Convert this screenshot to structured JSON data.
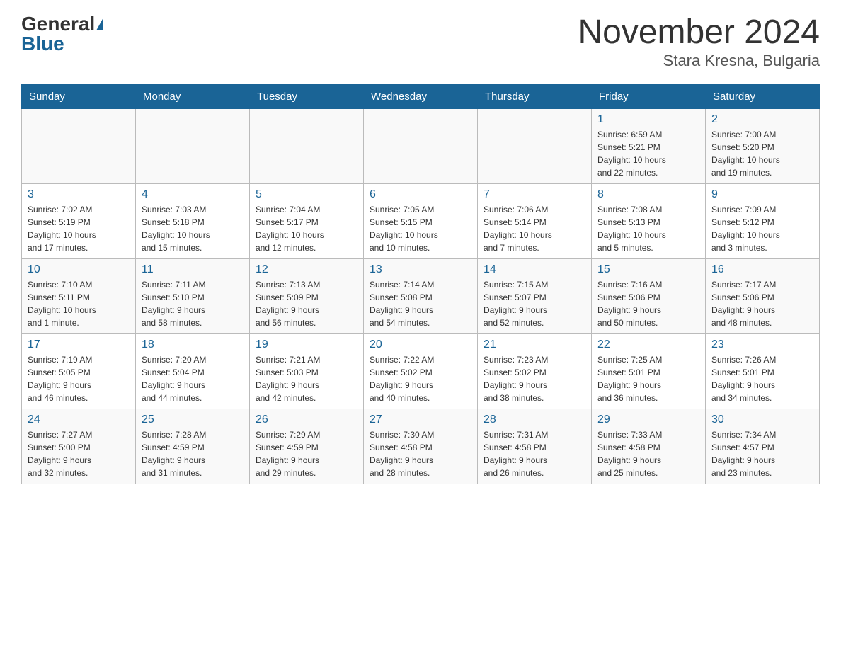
{
  "header": {
    "logo_general": "General",
    "logo_blue": "Blue",
    "title": "November 2024",
    "subtitle": "Stara Kresna, Bulgaria"
  },
  "weekdays": [
    "Sunday",
    "Monday",
    "Tuesday",
    "Wednesday",
    "Thursday",
    "Friday",
    "Saturday"
  ],
  "weeks": [
    [
      {
        "day": "",
        "info": ""
      },
      {
        "day": "",
        "info": ""
      },
      {
        "day": "",
        "info": ""
      },
      {
        "day": "",
        "info": ""
      },
      {
        "day": "",
        "info": ""
      },
      {
        "day": "1",
        "info": "Sunrise: 6:59 AM\nSunset: 5:21 PM\nDaylight: 10 hours\nand 22 minutes."
      },
      {
        "day": "2",
        "info": "Sunrise: 7:00 AM\nSunset: 5:20 PM\nDaylight: 10 hours\nand 19 minutes."
      }
    ],
    [
      {
        "day": "3",
        "info": "Sunrise: 7:02 AM\nSunset: 5:19 PM\nDaylight: 10 hours\nand 17 minutes."
      },
      {
        "day": "4",
        "info": "Sunrise: 7:03 AM\nSunset: 5:18 PM\nDaylight: 10 hours\nand 15 minutes."
      },
      {
        "day": "5",
        "info": "Sunrise: 7:04 AM\nSunset: 5:17 PM\nDaylight: 10 hours\nand 12 minutes."
      },
      {
        "day": "6",
        "info": "Sunrise: 7:05 AM\nSunset: 5:15 PM\nDaylight: 10 hours\nand 10 minutes."
      },
      {
        "day": "7",
        "info": "Sunrise: 7:06 AM\nSunset: 5:14 PM\nDaylight: 10 hours\nand 7 minutes."
      },
      {
        "day": "8",
        "info": "Sunrise: 7:08 AM\nSunset: 5:13 PM\nDaylight: 10 hours\nand 5 minutes."
      },
      {
        "day": "9",
        "info": "Sunrise: 7:09 AM\nSunset: 5:12 PM\nDaylight: 10 hours\nand 3 minutes."
      }
    ],
    [
      {
        "day": "10",
        "info": "Sunrise: 7:10 AM\nSunset: 5:11 PM\nDaylight: 10 hours\nand 1 minute."
      },
      {
        "day": "11",
        "info": "Sunrise: 7:11 AM\nSunset: 5:10 PM\nDaylight: 9 hours\nand 58 minutes."
      },
      {
        "day": "12",
        "info": "Sunrise: 7:13 AM\nSunset: 5:09 PM\nDaylight: 9 hours\nand 56 minutes."
      },
      {
        "day": "13",
        "info": "Sunrise: 7:14 AM\nSunset: 5:08 PM\nDaylight: 9 hours\nand 54 minutes."
      },
      {
        "day": "14",
        "info": "Sunrise: 7:15 AM\nSunset: 5:07 PM\nDaylight: 9 hours\nand 52 minutes."
      },
      {
        "day": "15",
        "info": "Sunrise: 7:16 AM\nSunset: 5:06 PM\nDaylight: 9 hours\nand 50 minutes."
      },
      {
        "day": "16",
        "info": "Sunrise: 7:17 AM\nSunset: 5:06 PM\nDaylight: 9 hours\nand 48 minutes."
      }
    ],
    [
      {
        "day": "17",
        "info": "Sunrise: 7:19 AM\nSunset: 5:05 PM\nDaylight: 9 hours\nand 46 minutes."
      },
      {
        "day": "18",
        "info": "Sunrise: 7:20 AM\nSunset: 5:04 PM\nDaylight: 9 hours\nand 44 minutes."
      },
      {
        "day": "19",
        "info": "Sunrise: 7:21 AM\nSunset: 5:03 PM\nDaylight: 9 hours\nand 42 minutes."
      },
      {
        "day": "20",
        "info": "Sunrise: 7:22 AM\nSunset: 5:02 PM\nDaylight: 9 hours\nand 40 minutes."
      },
      {
        "day": "21",
        "info": "Sunrise: 7:23 AM\nSunset: 5:02 PM\nDaylight: 9 hours\nand 38 minutes."
      },
      {
        "day": "22",
        "info": "Sunrise: 7:25 AM\nSunset: 5:01 PM\nDaylight: 9 hours\nand 36 minutes."
      },
      {
        "day": "23",
        "info": "Sunrise: 7:26 AM\nSunset: 5:01 PM\nDaylight: 9 hours\nand 34 minutes."
      }
    ],
    [
      {
        "day": "24",
        "info": "Sunrise: 7:27 AM\nSunset: 5:00 PM\nDaylight: 9 hours\nand 32 minutes."
      },
      {
        "day": "25",
        "info": "Sunrise: 7:28 AM\nSunset: 4:59 PM\nDaylight: 9 hours\nand 31 minutes."
      },
      {
        "day": "26",
        "info": "Sunrise: 7:29 AM\nSunset: 4:59 PM\nDaylight: 9 hours\nand 29 minutes."
      },
      {
        "day": "27",
        "info": "Sunrise: 7:30 AM\nSunset: 4:58 PM\nDaylight: 9 hours\nand 28 minutes."
      },
      {
        "day": "28",
        "info": "Sunrise: 7:31 AM\nSunset: 4:58 PM\nDaylight: 9 hours\nand 26 minutes."
      },
      {
        "day": "29",
        "info": "Sunrise: 7:33 AM\nSunset: 4:58 PM\nDaylight: 9 hours\nand 25 minutes."
      },
      {
        "day": "30",
        "info": "Sunrise: 7:34 AM\nSunset: 4:57 PM\nDaylight: 9 hours\nand 23 minutes."
      }
    ]
  ]
}
